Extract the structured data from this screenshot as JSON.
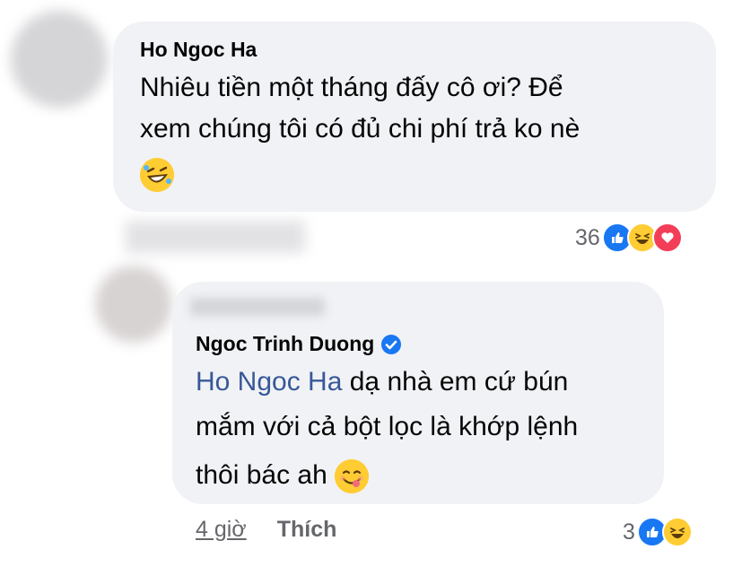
{
  "comment1": {
    "author": "Ho Ngoc Ha",
    "text_line1": "Nhiêu tiền một tháng đấy cô ơi? Để",
    "text_line2": "xem chúng tôi có đủ chi phí trả ko nè",
    "emoji": "rolling-on-floor-laughing",
    "reaction_count": "36",
    "reactions": [
      "like",
      "haha",
      "love"
    ]
  },
  "reply1": {
    "author": "Ngoc Trinh Duong",
    "verified": true,
    "mention": "Ho Ngoc Ha",
    "text_line1_rest": " dạ nhà em cứ bún",
    "text_line2": "mắm với cả bột lọc là khớp lệnh",
    "text_line3": "thôi bác ah ",
    "emoji": "face-savoring-food",
    "time": "4 giờ",
    "like_label": "Thích",
    "reaction_count": "3",
    "reactions": [
      "like",
      "haha"
    ]
  },
  "colors": {
    "bubble": "#f0f2f5",
    "mention": "#385898",
    "verified": "#1877f2",
    "meta_text": "#65676b"
  }
}
